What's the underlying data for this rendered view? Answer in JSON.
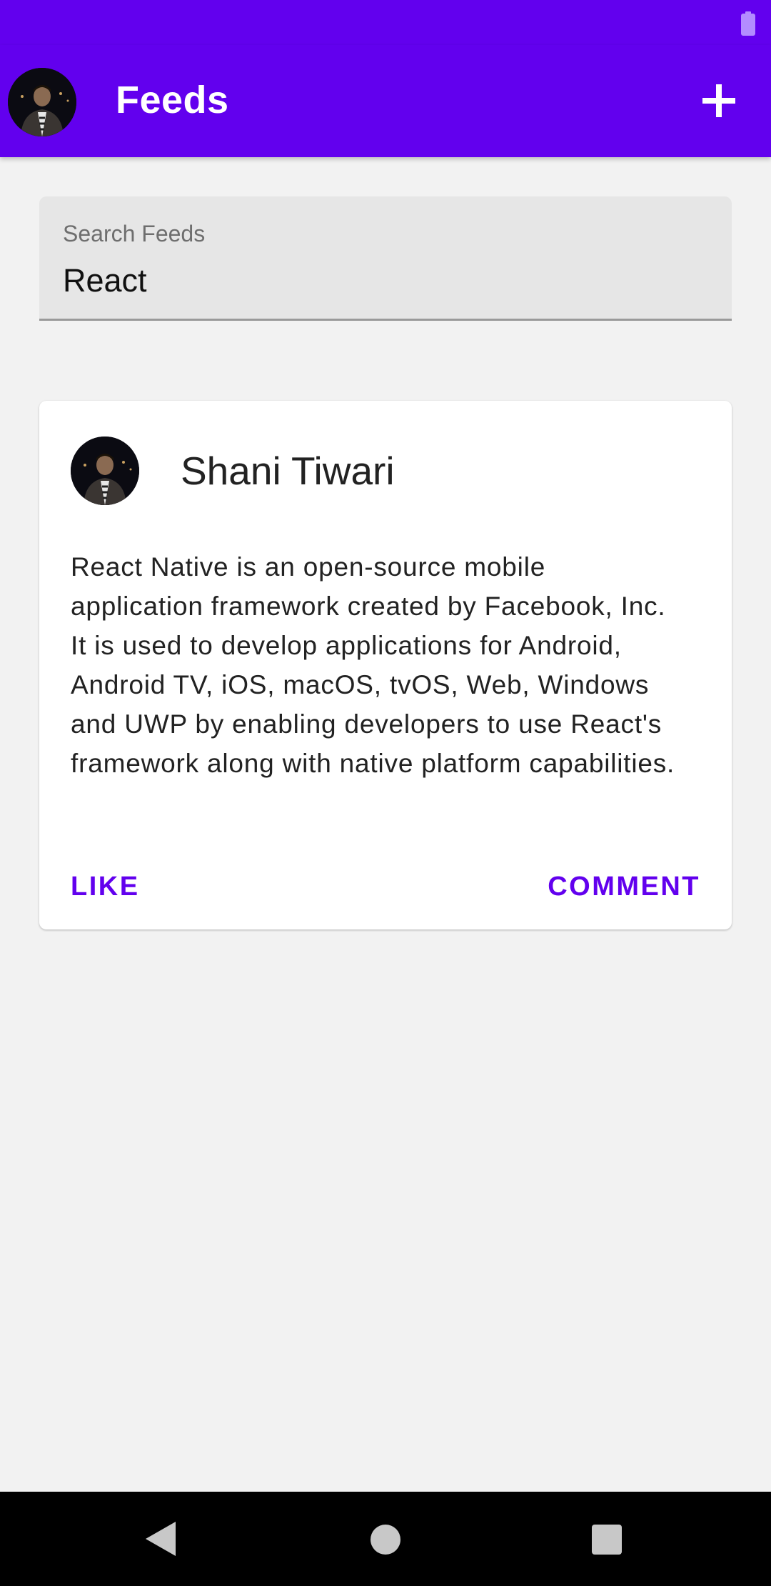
{
  "colors": {
    "primary": "#6200ee",
    "background": "#f2f2f2",
    "card": "#ffffff",
    "search_fill": "#e6e6e6",
    "text": "#222222",
    "nav_bar": "#000000"
  },
  "status_bar": {
    "icons": [
      "battery-icon"
    ]
  },
  "app_bar": {
    "title": "Feeds",
    "avatar_icon": "profile-avatar",
    "action_icon": "add-icon"
  },
  "search": {
    "label": "Search Feeds",
    "value": "React"
  },
  "feed": {
    "posts": [
      {
        "author": "Shani Tiwari",
        "avatar_icon": "author-avatar",
        "body": "React Native is an open-source mobile application framework created by Facebook, Inc. It is used to develop applications for Android, Android TV, iOS, macOS, tvOS, Web, Windows and UWP by enabling developers to use React's framework along with native platform capabilities.",
        "actions": {
          "like": "LIKE",
          "comment": "COMMENT"
        }
      }
    ]
  },
  "nav_bar": {
    "icons": [
      "back-icon",
      "home-icon",
      "recents-icon"
    ]
  }
}
